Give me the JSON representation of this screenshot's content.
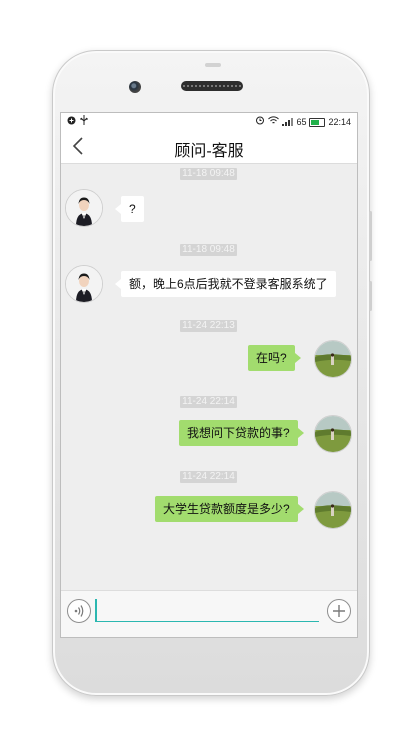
{
  "statusbar": {
    "left_icons": [
      "app-notification-icon",
      "usb-icon"
    ],
    "right_icons": [
      "alarm-icon",
      "wifi-icon",
      "signal-icon",
      "battery-icon"
    ],
    "battery_percent": "65",
    "battery_level": 0.65,
    "time": "22:14"
  },
  "header": {
    "title": "顾问-客服",
    "back_icon": "chevron-left-icon"
  },
  "messages": [
    {
      "timestamp": "11-18 09:48",
      "from": "agent",
      "text": "?"
    },
    {
      "timestamp": "11-18 09:48",
      "from": "agent",
      "text": "额，晚上6点后我就不登录客服系统了"
    },
    {
      "timestamp": "11-24 22:13",
      "from": "user",
      "text": "在吗?"
    },
    {
      "timestamp": "11-24 22:14",
      "from": "user",
      "text": "我想问下贷款的事?"
    },
    {
      "timestamp": "11-24 22:14",
      "from": "user",
      "text": "大学生贷款额度是多少?"
    }
  ],
  "inputbar": {
    "voice_icon": "voice-icon",
    "input_value": "",
    "input_placeholder": "",
    "plus_icon": "plus-icon"
  },
  "colors": {
    "outgoing_bubble": "#a2dc6e",
    "incoming_bubble": "#ffffff",
    "chat_background": "#eeeeee",
    "input_accent": "#2bb7b0"
  }
}
